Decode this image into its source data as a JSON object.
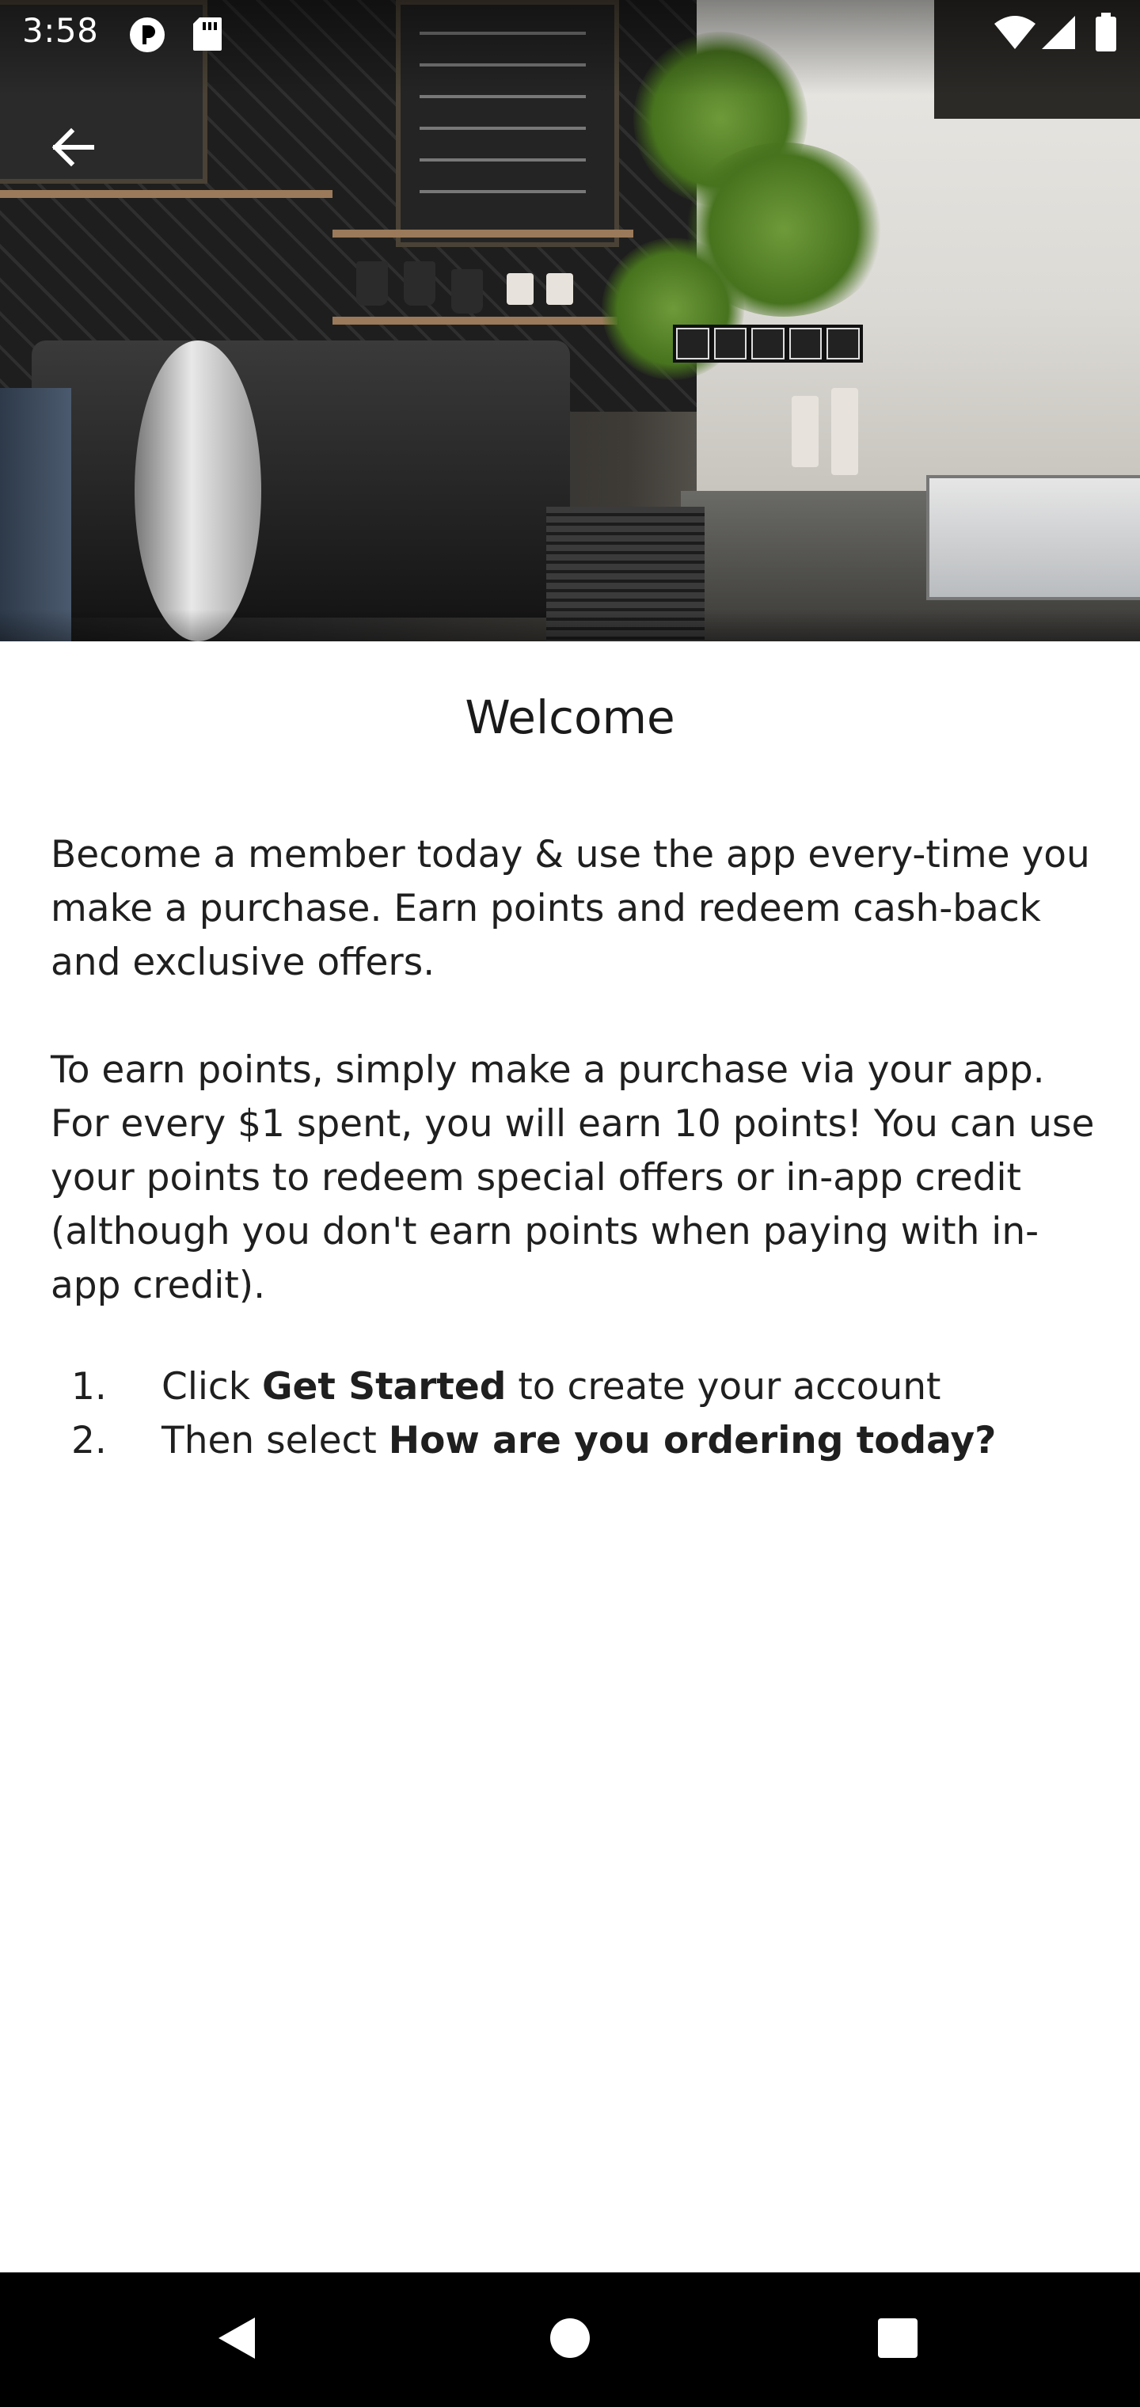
{
  "status_bar": {
    "time": "3:58",
    "icons": [
      "data-saver-icon",
      "sd-card-icon",
      "wifi-icon",
      "cell-signal-icon",
      "battery-icon"
    ]
  },
  "header": {
    "back_icon": "arrow-left-icon",
    "hero_image": "cafe-counter-photo"
  },
  "content": {
    "title": "Welcome",
    "paragraph1": "Become a member today & use the app every-time you make a purchase. Earn points and redeem cash-back and exclusive offers.",
    "paragraph2": "To earn points, simply make a purchase via your app. For every $1 spent, you will earn 10 points! You can use your points to redeem special offers or in-app credit (although you don't earn points when paying with in-app credit).",
    "steps": [
      {
        "number": "1.",
        "pre": "Click ",
        "bold": "Get Started",
        "post": " to create your account"
      },
      {
        "number": "2.",
        "pre": "Then select ",
        "bold": "How are you ordering today?",
        "post": ""
      }
    ]
  },
  "nav_bar": {
    "buttons": [
      "back-triangle-icon",
      "home-circle-icon",
      "recents-square-icon"
    ]
  }
}
